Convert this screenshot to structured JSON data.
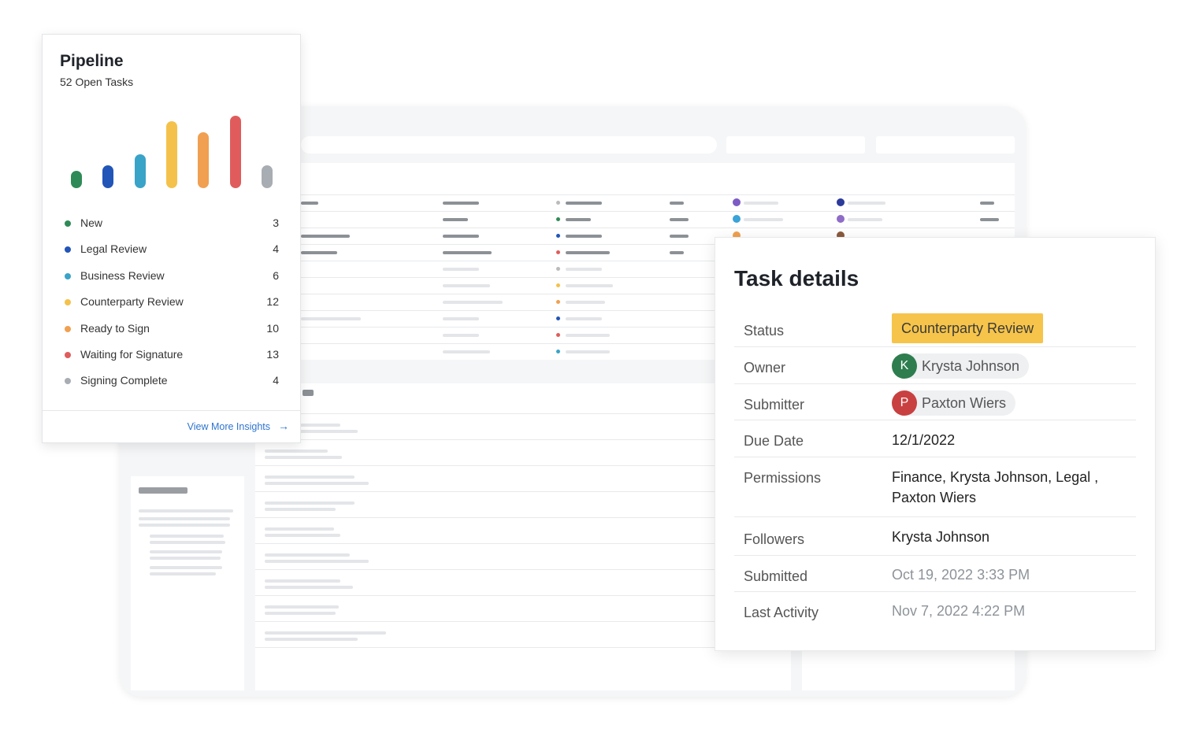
{
  "pipeline": {
    "title": "Pipeline",
    "subtitle": "52 Open Tasks",
    "link": "View More Insights",
    "arrow": "→",
    "statuses": [
      {
        "label": "New",
        "count": "3",
        "color": "#2e8b57",
        "value": 3
      },
      {
        "label": "Legal Review",
        "count": "4",
        "color": "#2255b8",
        "value": 4
      },
      {
        "label": "Business Review",
        "count": "6",
        "color": "#3aa3c8",
        "value": 6
      },
      {
        "label": "Counterparty Review",
        "count": "12",
        "color": "#f4c24a",
        "value": 12
      },
      {
        "label": "Ready to Sign",
        "count": "10",
        "color": "#f0a050",
        "value": 10
      },
      {
        "label": "Waiting for Signature",
        "count": "13",
        "color": "#e05c5c",
        "value": 13
      },
      {
        "label": "Signing Complete",
        "count": "4",
        "color": "#a8adb3",
        "value": 4
      }
    ]
  },
  "task": {
    "title": "Task details",
    "status_label": "Status",
    "status_value": "Counterparty Review",
    "status_color": "#f6c44a",
    "owner_label": "Owner",
    "owner": {
      "initial": "K",
      "name": "Krysta Johnson",
      "color": "#2e7d4f"
    },
    "submitter_label": "Submitter",
    "submitter": {
      "initial": "P",
      "name": "Paxton Wiers",
      "color": "#c94040"
    },
    "due_label": "Due Date",
    "due_value": "12/1/2022",
    "permissions_label": "Permissions",
    "permissions_line1": "Finance, Krysta Johnson, Legal ,",
    "permissions_line2": "Paxton Wiers",
    "followers_label": "Followers",
    "followers_value": "Krysta Johnson",
    "submitted_label": "Submitted",
    "submitted_value": "Oct 19, 2022 3:33 PM",
    "last_activity_label": "Last Activity",
    "last_activity_value": "Nov 7, 2022 4:22 PM"
  }
}
